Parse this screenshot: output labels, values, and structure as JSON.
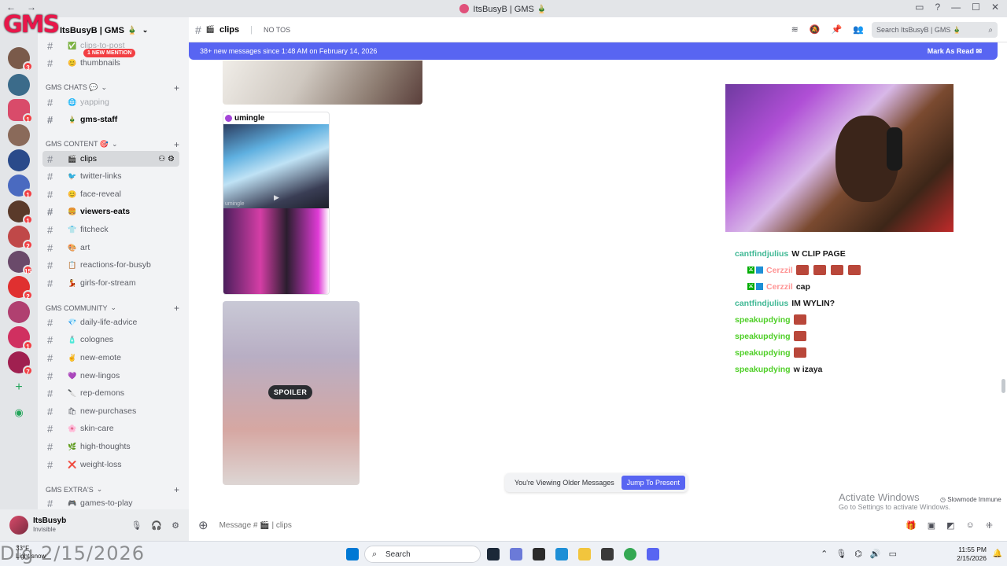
{
  "window": {
    "title": "ItsBusyB | GMS 🎍"
  },
  "server_rail": {
    "logo_text": "GMS"
  },
  "sidebar": {
    "guild_name": "ItsBusyB | GMS 🎍",
    "mention_pill": "1 NEW MENTION",
    "channels_top": [
      {
        "emoji": "✅",
        "label": "clips-to-post"
      },
      {
        "emoji": "😊",
        "label": "thumbnails"
      }
    ],
    "cat_chats": "GMS CHATS 💬",
    "chats": [
      {
        "emoji": "🌐",
        "label": "yapping"
      },
      {
        "emoji": "🎍",
        "label": "gms-staff"
      }
    ],
    "cat_content": "GMS CONTENT 🎯",
    "content": [
      {
        "emoji": "🎬",
        "label": "clips"
      },
      {
        "emoji": "🐦",
        "label": "twitter-links"
      },
      {
        "emoji": "😊",
        "label": "face-reveal"
      },
      {
        "emoji": "🍔",
        "label": "viewers-eats"
      },
      {
        "emoji": "👕",
        "label": "fitcheck"
      },
      {
        "emoji": "🎨",
        "label": "art"
      },
      {
        "emoji": "📋",
        "label": "reactions-for-busyb"
      },
      {
        "emoji": "💃",
        "label": "girls-for-stream"
      }
    ],
    "cat_community": "GMS COMMUNITY",
    "community": [
      {
        "emoji": "💎",
        "label": "daily-life-advice"
      },
      {
        "emoji": "🧴",
        "label": "colognes"
      },
      {
        "emoji": "✌",
        "label": "new-emote"
      },
      {
        "emoji": "💜",
        "label": "new-lingos"
      },
      {
        "emoji": "🔪",
        "label": "rep-demons"
      },
      {
        "emoji": "🛍",
        "label": "new-purchases"
      },
      {
        "emoji": "🌸",
        "label": "skin-care"
      },
      {
        "emoji": "🌿",
        "label": "high-thoughts"
      },
      {
        "emoji": "❌",
        "label": "weight-loss"
      }
    ],
    "cat_extras": "GMS EXTRA'S",
    "extras": [
      {
        "emoji": "🎮",
        "label": "games-to-play"
      }
    ]
  },
  "user": {
    "name": "ItsBusyb",
    "status": "Invisible"
  },
  "header": {
    "channel": "clips",
    "topic": "NO TOS",
    "search_placeholder": "Search ItsBusyB | GMS 🎍"
  },
  "new_messages_bar": {
    "text": "38+ new messages since 1:48 AM on February 14, 2026",
    "action": "Mark As Read"
  },
  "embed": {
    "provider": "umingle",
    "watermark": "umingle"
  },
  "spoiler": {
    "label": "SPOILER"
  },
  "older_notice": {
    "text": "You're Viewing Older Messages",
    "button": "Jump To Present"
  },
  "composer": {
    "placeholder": "Message # 🎬 | clips"
  },
  "overlay": {
    "activate_title": "Activate Windows",
    "activate_sub": "Go to Settings to activate Windows.",
    "slowmode": "Slowmode Immune"
  },
  "stream_chat": [
    {
      "user": "cantfindjulius",
      "msg": "W CLIP PAGE",
      "style": "teal",
      "emotes": 0
    },
    {
      "user": "Cerzzil",
      "msg": "",
      "style": "red",
      "emotes": 4
    },
    {
      "user": "Cerzzil",
      "msg": "cap",
      "style": "red",
      "emotes": 0
    },
    {
      "user": "cantfindjulius",
      "msg": "IM WYLIN?",
      "style": "teal",
      "emotes": 0
    },
    {
      "user": "speakupdying",
      "msg": "",
      "style": "green",
      "emotes": 1
    },
    {
      "user": "speakupdying",
      "msg": "",
      "style": "green",
      "emotes": 1
    },
    {
      "user": "speakupdying",
      "msg": "",
      "style": "green",
      "emotes": 1
    },
    {
      "user": "speakupdying",
      "msg": "w izaya",
      "style": "green",
      "emotes": 0
    }
  ],
  "taskbar": {
    "search": "Search",
    "weather_temp": "33°F",
    "weather_desc": "Light snow",
    "time": "11:55 PM",
    "date": "2/15/2026",
    "date_overlay": "Dig 2/15/2026"
  },
  "colors": {
    "blurple": "#5865f2",
    "mention_red": "#f23f43",
    "chat_teal": "#3fb894",
    "chat_green": "#4fcf27"
  }
}
